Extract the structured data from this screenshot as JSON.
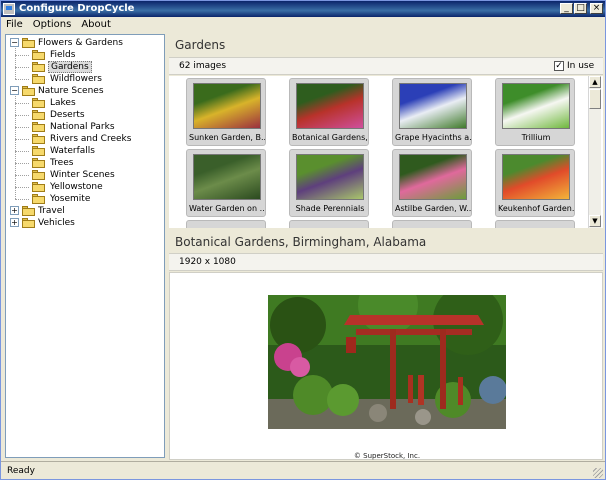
{
  "window": {
    "title": "Configure DropCycle",
    "buttons": [
      "_",
      "□",
      "×"
    ]
  },
  "menu": [
    "File",
    "Options",
    "About"
  ],
  "tree": [
    {
      "label": "Flowers & Gardens",
      "expanded": true,
      "children": [
        {
          "label": "Fields"
        },
        {
          "label": "Gardens",
          "selected": true
        },
        {
          "label": "Wildflowers"
        }
      ]
    },
    {
      "label": "Nature Scenes",
      "expanded": true,
      "children": [
        {
          "label": "Lakes"
        },
        {
          "label": "Deserts"
        },
        {
          "label": "National Parks"
        },
        {
          "label": "Rivers and Creeks"
        },
        {
          "label": "Waterfalls"
        },
        {
          "label": "Trees"
        },
        {
          "label": "Winter Scenes"
        },
        {
          "label": "Yellowstone"
        },
        {
          "label": "Yosemite"
        }
      ]
    },
    {
      "label": "Travel",
      "expanded": false,
      "children": []
    },
    {
      "label": "Vehicles",
      "expanded": false,
      "children": []
    }
  ],
  "gallery": {
    "title": "Gardens",
    "count": "62 images",
    "in_use_label": "In use",
    "in_use_checked": true,
    "check_mark": "✓",
    "thumbnails": [
      {
        "caption": "Sunken Garden, B...",
        "colors": [
          "#3a6b1c",
          "#d8b32a",
          "#9b2f3f"
        ]
      },
      {
        "caption": "Botanical Gardens,...",
        "colors": [
          "#2e5d1e",
          "#b8322a",
          "#cf4f9d"
        ]
      },
      {
        "caption": "Grape Hyacinths a...",
        "colors": [
          "#2b3fb7",
          "#e9edf4",
          "#3f7a2a"
        ]
      },
      {
        "caption": "Trillium",
        "colors": [
          "#3e8d2a",
          "#f6f7f2",
          "#6fb83d"
        ]
      },
      {
        "caption": "Water Garden on ...",
        "colors": [
          "#3a5f2a",
          "#6c8c4a",
          "#2b4a1f"
        ]
      },
      {
        "caption": "Shade Perennials",
        "colors": [
          "#5a8f2e",
          "#5e3f7d",
          "#a9c66b"
        ]
      },
      {
        "caption": "Astilbe Garden, W...",
        "colors": [
          "#2f5a1e",
          "#e0699c",
          "#6b9d3a"
        ]
      },
      {
        "caption": "Keukenhof Garden...",
        "colors": [
          "#4c8a2e",
          "#e14b2a",
          "#f2b43a"
        ]
      }
    ],
    "scroll_up": "▲",
    "scroll_down": "▼"
  },
  "detail": {
    "title": "Botanical Gardens, Birmingham, Alabama",
    "resolution": "1920 x 1080",
    "copyright": "© SuperStock, Inc."
  },
  "status": "Ready"
}
